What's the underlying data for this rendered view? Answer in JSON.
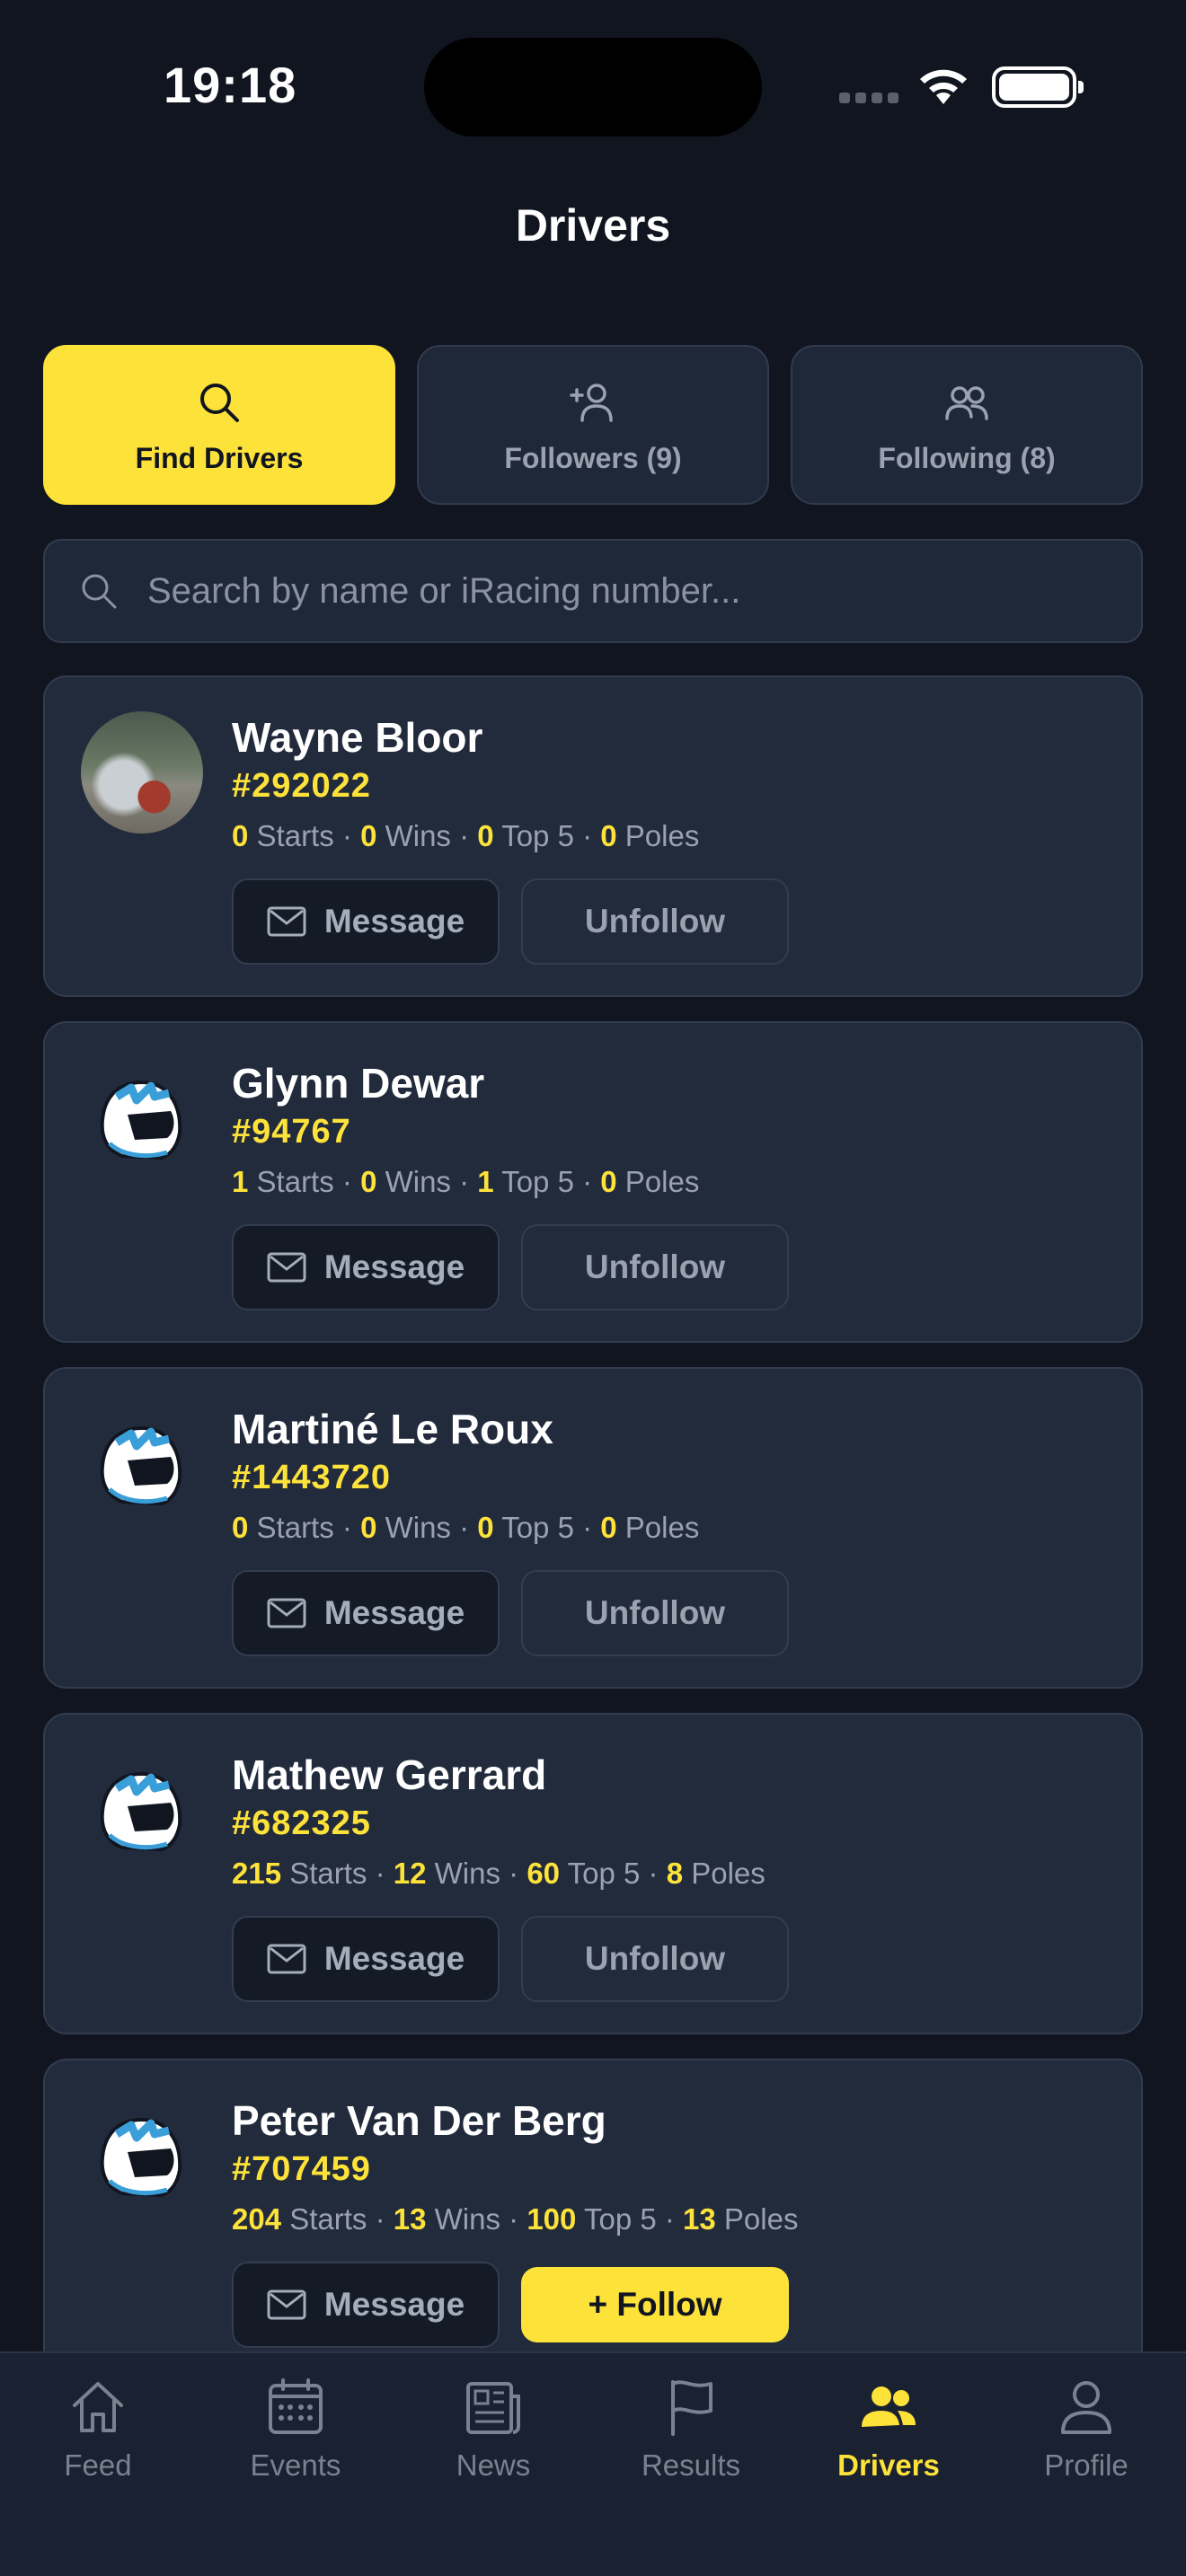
{
  "status": {
    "time": "19:18"
  },
  "header": {
    "title": "Drivers"
  },
  "segments": [
    {
      "label": "Find Drivers",
      "icon": "search-icon",
      "active": true
    },
    {
      "label": "Followers (9)",
      "icon": "add-user-icon",
      "active": false
    },
    {
      "label": "Following (8)",
      "icon": "users-icon",
      "active": false
    }
  ],
  "search": {
    "placeholder": "Search by name or iRacing number..."
  },
  "labels": {
    "starts": "Starts",
    "wins": "Wins",
    "top5": "Top 5",
    "poles": "Poles",
    "message": "Message",
    "unfollow": "Unfollow",
    "follow": "+ Follow"
  },
  "drivers": [
    {
      "name": "Wayne Bloor",
      "number": "#292022",
      "starts": "0",
      "wins": "0",
      "top5": "0",
      "poles": "0",
      "avatar": "photo"
    },
    {
      "name": "Glynn Dewar",
      "number": "#94767",
      "starts": "1",
      "wins": "0",
      "top5": "1",
      "poles": "0",
      "avatar": "helmet-icon"
    },
    {
      "name": "Martiné Le Roux",
      "number": "#1443720",
      "starts": "0",
      "wins": "0",
      "top5": "0",
      "poles": "0",
      "avatar": "helmet-icon"
    },
    {
      "name": "Mathew Gerrard",
      "number": "#682325",
      "starts": "215",
      "wins": "12",
      "top5": "60",
      "poles": "8",
      "avatar": "helmet-icon"
    },
    {
      "name": "Peter Van Der Berg",
      "number": "#707459",
      "starts": "204",
      "wins": "13",
      "top5": "100",
      "poles": "13",
      "avatar": "helmet-icon"
    }
  ],
  "tabs": [
    {
      "label": "Feed",
      "icon": "home-icon"
    },
    {
      "label": "Events",
      "icon": "calendar-icon"
    },
    {
      "label": "News",
      "icon": "newspaper-icon"
    },
    {
      "label": "Results",
      "icon": "flag-icon"
    },
    {
      "label": "Drivers",
      "icon": "users-icon",
      "active": true
    },
    {
      "label": "Profile",
      "icon": "person-icon"
    }
  ],
  "colors": {
    "accent": "#fde23a",
    "background": "#111520",
    "card": "#222b3c"
  }
}
